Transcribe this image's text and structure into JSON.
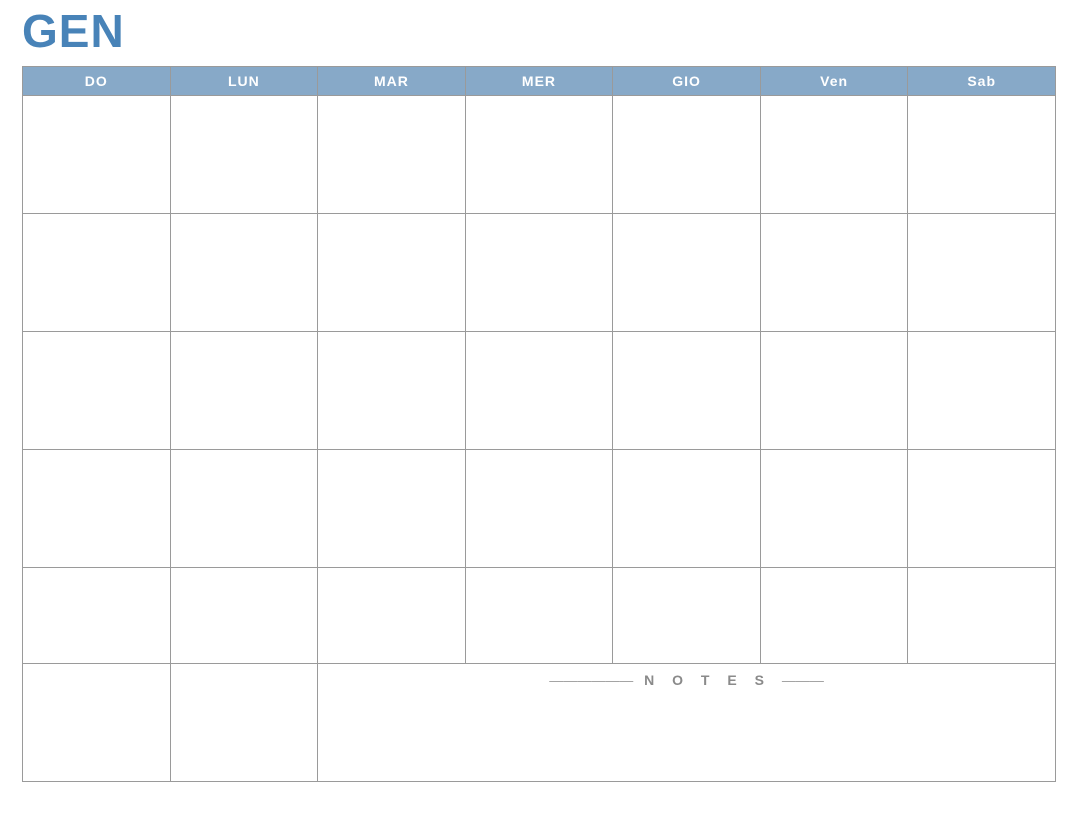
{
  "month_title": "GEN",
  "weekdays": [
    "DO",
    "LUN",
    "MAR",
    "MER",
    "GIO",
    "Ven",
    "Sab"
  ],
  "notes_label": "N O T E S",
  "notes_dash_left": "——————",
  "notes_dash_right": "———"
}
